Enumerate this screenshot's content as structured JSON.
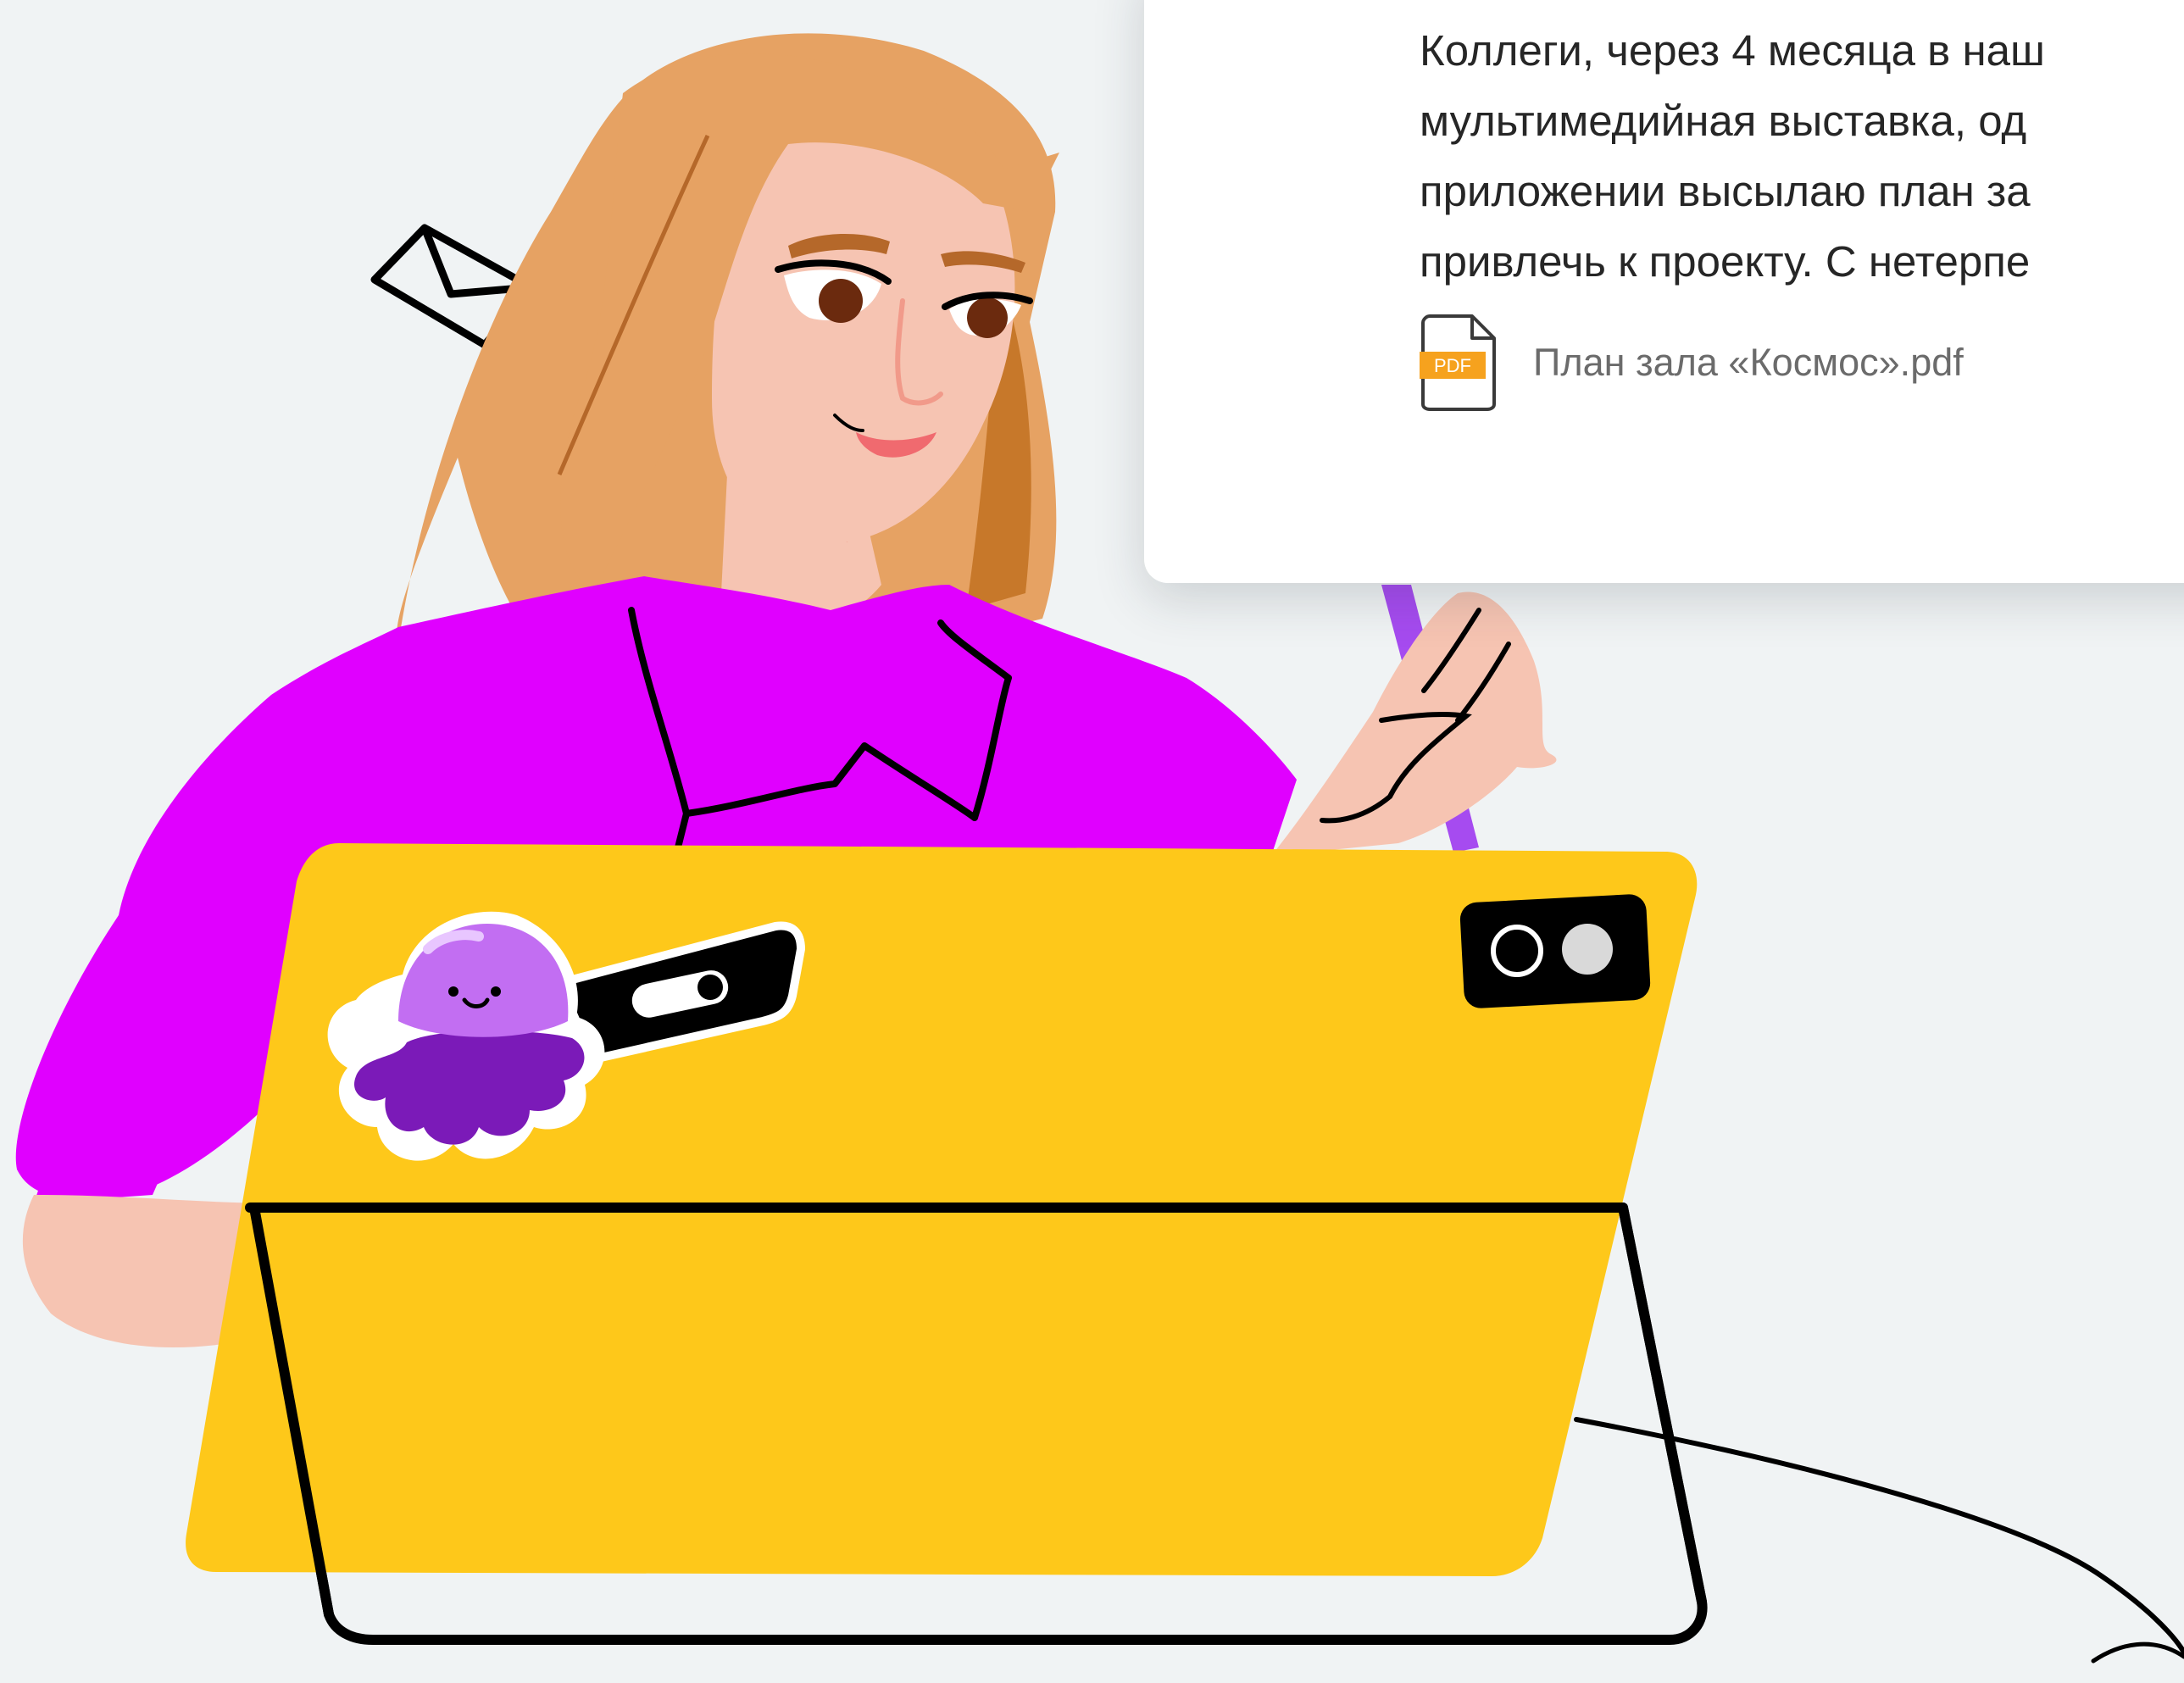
{
  "email": {
    "body": "Коллеги, через 4 месяца в наш\nмультимедийная выставка, од\nприложении высылаю план за\nпривлечь к проекту. С нетерпе",
    "attachment": {
      "icon": "pdf-file-icon",
      "badge": "PDF",
      "file_name": "План зала «Космос».pdf"
    }
  },
  "colors": {
    "background": "#f0f3f4",
    "shirt": "#e000ff",
    "tablet": "#fec81a",
    "hair": "#e6a263",
    "skin": "#f6c4b2",
    "mascot": "#c26ef2",
    "pdf_badge": "#f6a21e"
  },
  "decor": {
    "envelope_icon": "envelope-icon",
    "mascot_sticker": "octopus-sticker-icon",
    "camera_icon": "camera-icon",
    "stylus_icon": "stylus-icon"
  }
}
